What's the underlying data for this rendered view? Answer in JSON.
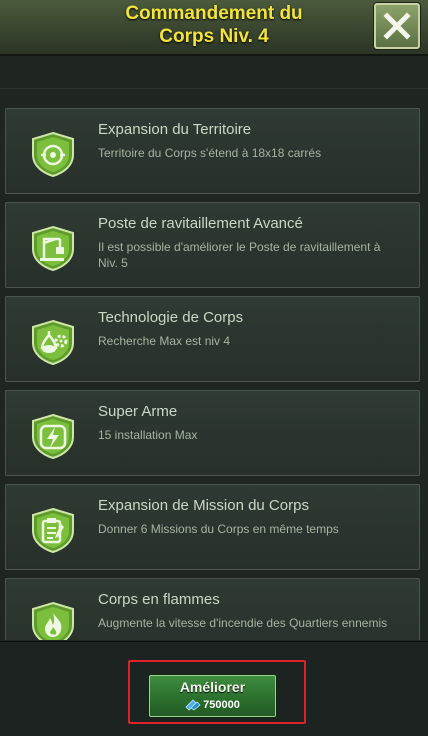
{
  "header": {
    "title_line1": "Commandement du",
    "title_line2": "Corps Niv. 4",
    "close_icon": "close-x-icon"
  },
  "features": [
    {
      "title": "Expansion du Territoire",
      "desc": "Territoire du Corps s'étend à 18x18 carrés",
      "icon": "territory-target-icon"
    },
    {
      "title": "Poste de ravitaillement Avancé",
      "desc": "Il est possible d'améliorer le Poste de ravitaillement à Niv. 5",
      "icon": "supply-crane-icon"
    },
    {
      "title": "Technologie de Corps",
      "desc": "Recherche Max est niv 4",
      "icon": "technology-flask-icon"
    },
    {
      "title": "Super Arme",
      "desc": "15 installation Max",
      "icon": "lightning-bolt-icon"
    },
    {
      "title": "Expansion de Mission du Corps",
      "desc": "Donner 6 Missions du Corps en même temps",
      "icon": "mission-clipboard-icon"
    },
    {
      "title": "Corps en flammes",
      "desc": "Augmente la vitesse d'incendie des Quartiers ennemis",
      "icon": "flame-icon"
    }
  ],
  "footer": {
    "upgrade_label": "Améliorer",
    "cost_value": "750000",
    "cost_icon": "blue-resource-icon"
  },
  "colors": {
    "title": "#f2e33f",
    "badge_green": "#7cbf3c",
    "highlight": "#e0232a",
    "button_green": "#2b6e2d"
  }
}
